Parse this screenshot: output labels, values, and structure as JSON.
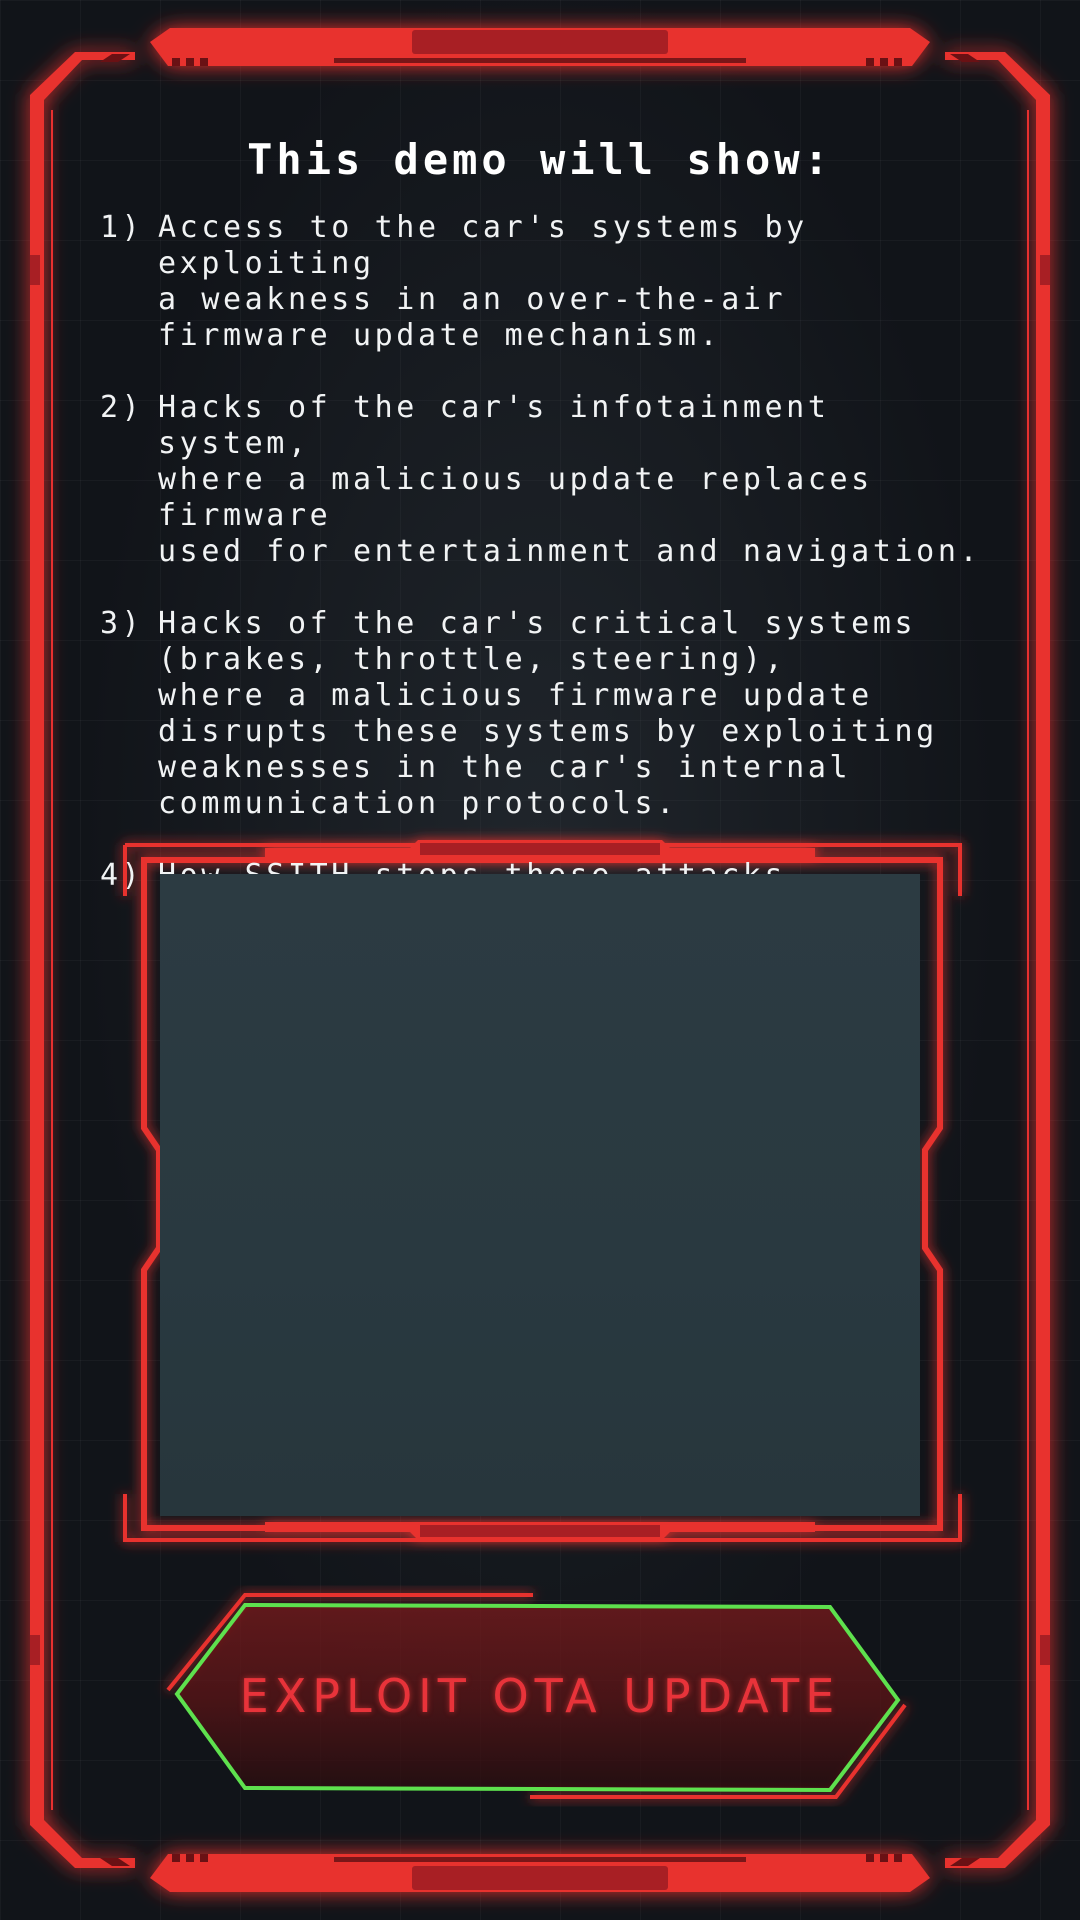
{
  "intro": {
    "title": "This demo will show:",
    "items": [
      {
        "number": "1)",
        "text": "Access to the car's systems by exploiting\na weakness in an over-the-air\nfirmware update mechanism."
      },
      {
        "number": "2)",
        "text": "Hacks of the car's infotainment system,\nwhere a malicious update replaces firmware\nused for entertainment and navigation."
      },
      {
        "number": "3)",
        "text": "Hacks of the car's critical systems\n(brakes, throttle, steering),\nwhere a malicious firmware update\ndisrupts these systems by exploiting\nweaknesses in the car's internal\ncommunication protocols."
      },
      {
        "number": "4)",
        "text": "How SSITH stops these attacks."
      }
    ]
  },
  "action": {
    "exploit_button_label": "EXPLOIT OTA UPDATE"
  },
  "colors": {
    "frame_red": "#e8302f",
    "button_outline_green": "#5ee14e",
    "background": "#111419",
    "panel": "#2a3a41"
  },
  "icons": {
    "exploit_button_shape": "hexagon-outline"
  }
}
